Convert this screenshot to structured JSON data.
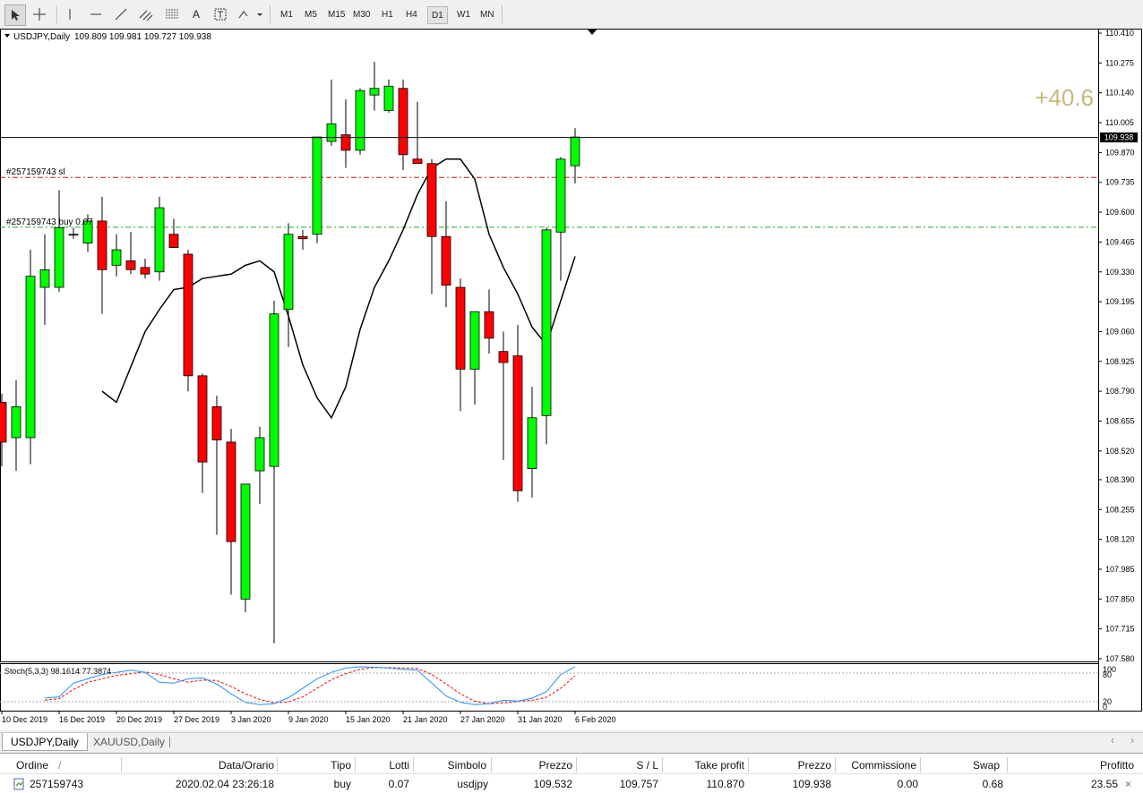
{
  "toolbar": {
    "timeframes": [
      "M1",
      "M5",
      "M15",
      "M30",
      "H1",
      "H4",
      "D1",
      "W1",
      "MN"
    ],
    "active_timeframe": "D1"
  },
  "chart_header": {
    "symbol_tf": "USDJPY,Daily",
    "ohlc": "109.809 109.981 109.727 109.938"
  },
  "order_lines": {
    "sl_label": "#257159743 sl",
    "buy_label": "#257159743 buy 0.07",
    "sl_color": "#d21a1a",
    "buy_color": "#22aa22"
  },
  "profit_overlay": "+40.6",
  "current_price_label": "109.938",
  "stoch_label": "Stoch(5,3,3) 98.1614 77.3874",
  "stoch_levels": [
    "100",
    "80",
    "20",
    "0"
  ],
  "colors": {
    "bull": "#00ff00",
    "bear": "#ff0000",
    "ma": "#000000",
    "stoch_main": "#1e90ff",
    "stoch_signal": "#ff0000",
    "profit": "#c8b878"
  },
  "chart_data": {
    "type": "candlestick",
    "ylim": [
      107.58,
      110.41
    ],
    "y_ticks": [
      110.41,
      110.275,
      110.14,
      110.005,
      109.87,
      109.735,
      109.6,
      109.465,
      109.33,
      109.195,
      109.06,
      108.925,
      108.79,
      108.655,
      108.52,
      108.39,
      108.255,
      108.12,
      107.985,
      107.85,
      107.715,
      107.58
    ],
    "x_labels": [
      "10 Dec 2019",
      "16 Dec 2019",
      "20 Dec 2019",
      "27 Dec 2019",
      "3 Jan 2020",
      "9 Jan 2020",
      "15 Jan 2020",
      "21 Jan 2020",
      "27 Jan 2020",
      "31 Jan 2020",
      "6 Feb 2020"
    ],
    "ohlc": [
      [
        108.74,
        108.78,
        108.45,
        108.56
      ],
      [
        108.58,
        108.84,
        108.43,
        108.72
      ],
      [
        108.58,
        109.43,
        108.46,
        109.31
      ],
      [
        109.26,
        109.5,
        109.09,
        109.34
      ],
      [
        109.26,
        109.7,
        109.24,
        109.53
      ],
      [
        109.5,
        109.53,
        109.48,
        109.5
      ],
      [
        109.46,
        109.59,
        109.42,
        109.56
      ],
      [
        109.56,
        109.67,
        109.14,
        109.34
      ],
      [
        109.36,
        109.5,
        109.31,
        109.43
      ],
      [
        109.38,
        109.51,
        109.32,
        109.34
      ],
      [
        109.35,
        109.39,
        109.3,
        109.32
      ],
      [
        109.33,
        109.67,
        109.29,
        109.62
      ],
      [
        109.5,
        109.57,
        109.44,
        109.44
      ],
      [
        109.41,
        109.43,
        108.79,
        108.86
      ],
      [
        108.86,
        108.87,
        108.33,
        108.47
      ],
      [
        108.72,
        108.77,
        108.14,
        108.57
      ],
      [
        108.56,
        108.62,
        107.87,
        108.11
      ],
      [
        107.85,
        108.37,
        107.79,
        108.37
      ],
      [
        108.43,
        108.63,
        108.28,
        108.58
      ],
      [
        108.45,
        109.2,
        107.65,
        109.14
      ],
      [
        109.16,
        109.55,
        108.99,
        109.5
      ],
      [
        109.49,
        109.52,
        109.43,
        109.48
      ],
      [
        109.5,
        109.94,
        109.46,
        109.94
      ],
      [
        109.92,
        110.2,
        109.9,
        110
      ],
      [
        109.95,
        110.11,
        109.8,
        109.88
      ],
      [
        109.88,
        110.16,
        109.86,
        110.15
      ],
      [
        110.13,
        110.28,
        110.06,
        110.16
      ],
      [
        110.06,
        110.2,
        110.05,
        110.17
      ],
      [
        110.16,
        110.2,
        109.79,
        109.86
      ],
      [
        109.84,
        110.1,
        109.82,
        109.82
      ],
      [
        109.82,
        109.84,
        109.23,
        109.49
      ],
      [
        109.49,
        109.65,
        109.17,
        109.27
      ],
      [
        109.26,
        109.3,
        108.7,
        108.89
      ],
      [
        108.89,
        109.15,
        108.73,
        109.15
      ],
      [
        109.15,
        109.25,
        108.96,
        109.03
      ],
      [
        108.97,
        109.06,
        108.48,
        108.92
      ],
      [
        108.95,
        109.09,
        108.29,
        108.34
      ],
      [
        108.44,
        108.81,
        108.31,
        108.67
      ],
      [
        108.68,
        109.53,
        108.55,
        109.52
      ],
      [
        109.51,
        109.85,
        109.29,
        109.84
      ],
      [
        109.81,
        109.98,
        109.73,
        109.94
      ]
    ],
    "ma": [
      108.79,
      108.74,
      108.9,
      109.06,
      109.16,
      109.25,
      109.26,
      109.3,
      109.31,
      109.32,
      109.36,
      109.38,
      109.33,
      109.13,
      108.91,
      108.76,
      108.67,
      108.81,
      109.07,
      109.26,
      109.38,
      109.52,
      109.68,
      109.8,
      109.84,
      109.84,
      109.75,
      109.5,
      109.35,
      109.23,
      109.08,
      109,
      109.2,
      109.4
    ],
    "stochastic": {
      "main": [
        25,
        28,
        60,
        70,
        80,
        85,
        90,
        85,
        62,
        60,
        70,
        72,
        58,
        35,
        15,
        10,
        12,
        26,
        48,
        70,
        85,
        95,
        98,
        97,
        95,
        92,
        90,
        60,
        30,
        15,
        10,
        12,
        20,
        18,
        25,
        40,
        80,
        98
      ],
      "signal": [
        20,
        24,
        45,
        62,
        70,
        78,
        82,
        86,
        80,
        70,
        62,
        67,
        66,
        52,
        35,
        22,
        14,
        16,
        28,
        48,
        68,
        82,
        92,
        96,
        96,
        95,
        94,
        80,
        58,
        35,
        18,
        12,
        14,
        17,
        20,
        27,
        48,
        77
      ]
    }
  },
  "tabs": [
    "USDJPY,Daily",
    "XAUUSD,Daily"
  ],
  "terminal": {
    "headers": [
      "Ordine",
      "/",
      "Data/Orario",
      "Tipo",
      "Lotti",
      "Simbolo",
      "Prezzo",
      "S / L",
      "Take profit",
      "Prezzo",
      "Commissione",
      "Swap",
      "Profitto"
    ],
    "row": [
      "257159743",
      "2020.02.04 23:26:18",
      "buy",
      "0.07",
      "usdjpy",
      "109.532",
      "109.757",
      "110.870",
      "109.938",
      "0.00",
      "0.68",
      "23.55"
    ]
  }
}
